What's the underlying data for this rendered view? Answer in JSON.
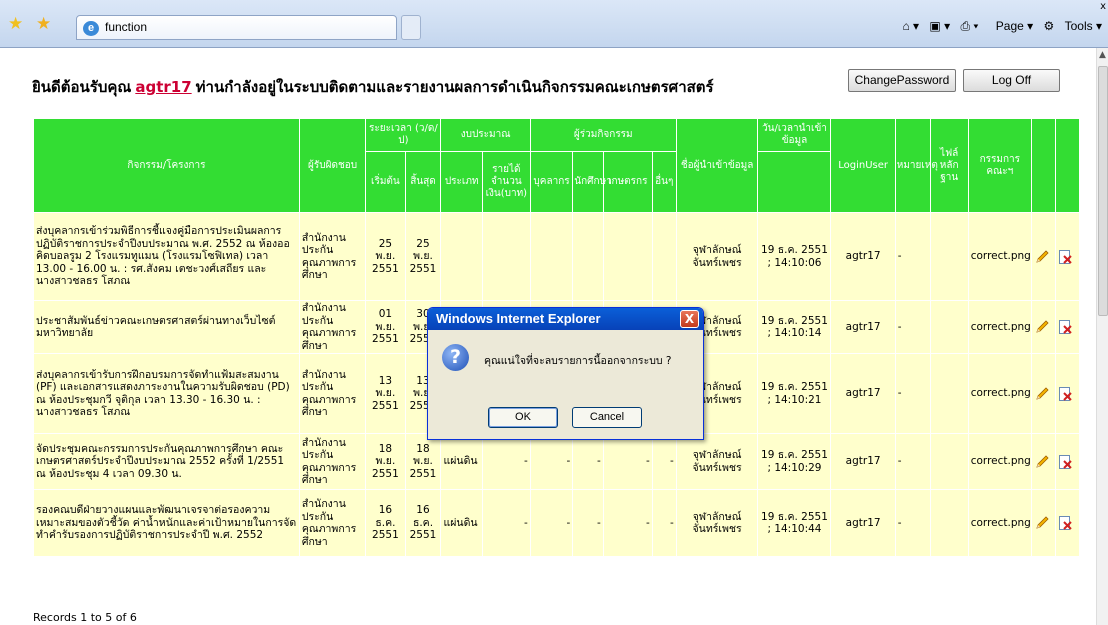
{
  "browser": {
    "tab_title": "function",
    "tools": [
      "Page",
      "Tools"
    ],
    "close_glyph": "x"
  },
  "header": {
    "welcome_prefix": "ยินดีต้อนรับคุณ",
    "username": "agtr17",
    "welcome_suffix": "ท่านกำลังอยู่ในระบบติดตามและรายงานผลการดำเนินกิจกรรมคณะเกษตรศาสตร์",
    "change_password": "ChangePassword",
    "log_off": "Log Off"
  },
  "table": {
    "headers": {
      "activity": "กิจกรรม/โครงการ",
      "responsible": "ผู้รับผิดชอบ",
      "period": "ระยะเวลา (ว/ด/ป)",
      "budget": "งบประมาณ",
      "participants": "ผู้ร่วมกิจกรรม",
      "entered_by": "ชื่อผู้นำเข้าข้อมูล",
      "entered_at": "วัน/เวลานำเข้าข้อมูล",
      "login_user": "LoginUser",
      "note": "หมายเหตุ",
      "evidence": "ไฟล์หลักฐาน",
      "committee": "กรรมการคณะฯ",
      "start": "เริ่มต้น",
      "end": "สิ้นสุด",
      "type": "ประเภท",
      "amount": "รายได้จำนวนเงิน(บาท)",
      "staff": "บุคลากร",
      "student": "นักศึกษา",
      "farmer": "เกษตรกร",
      "other": "อื่นๆ"
    },
    "rows": [
      {
        "activity": "ส่งบุคลากรเข้าร่วมพิธีการชี้แจงคู่มือการประเมินผลการปฏิบัติราชการประจำปีงบประมาณ พ.ศ. 2552 ณ ห้องออคิดบอลรูม 2 โรงแรมทูแมน (โรงแรมโซฟิเทล) เวลา 13.00 - 16.00 น. : รศ.สังคม เตชะวงศ์เสถียร และนางสาวชลธร โสภณ",
        "responsible": "สำนักงานประกันคุณภาพการศึกษา",
        "start": "25 พ.ย. 2551",
        "end": "25 พ.ย. 2551",
        "type": "",
        "amount": "",
        "staff": "",
        "student": "",
        "farmer": "",
        "other": "",
        "entered_by": "จุฬาลักษณ์ จันทร์เพชร",
        "entered_at": "19 ธ.ค. 2551 ; 14:10:06",
        "login_user": "agtr17",
        "note": "-",
        "evidence": "",
        "committee": "correct.png"
      },
      {
        "activity": "ประชาสัมพันธ์ข่าวคณะเกษตรศาสตร์ผ่านทางเว็บไซต์มหาวิทยาลัย",
        "responsible": "สำนักงานประกันคุณภาพการศึกษา",
        "start": "01 พ.ย. 2551",
        "end": "30 พ.ย. 2551",
        "type": "",
        "amount": "",
        "staff": "",
        "student": "",
        "farmer": "",
        "other": "",
        "entered_by": "จุฬาลักษณ์ จันทร์เพชร",
        "entered_at": "19 ธ.ค. 2551 ; 14:10:14",
        "login_user": "agtr17",
        "note": "-",
        "evidence": "",
        "committee": "correct.png"
      },
      {
        "activity": "ส่งบุคลากรเข้ารับการฝึกอบรมการจัดทำแฟ้มสะสมงาน (PF) และเอกสารแสดงภาระงานในความรับผิดชอบ (PD) ณ ห้องประชุมกวี จุติกุล เวลา 13.30 - 16.30 น. : นางสาวชลธร โสภณ",
        "responsible": "สำนักงานประกันคุณภาพการศึกษา",
        "start": "13 พ.ย. 2551",
        "end": "13 พ.ย. 2551",
        "type": "แผ่นดิน",
        "amount": "-",
        "staff": "-",
        "student": "-",
        "farmer": "-",
        "other": "-",
        "entered_by": "จุฬาลักษณ์ จันทร์เพชร",
        "entered_at": "19 ธ.ค. 2551 ; 14:10:21",
        "login_user": "agtr17",
        "note": "-",
        "evidence": "",
        "committee": "correct.png"
      },
      {
        "activity": "จัดประชุมคณะกรรมการประกันคุณภาพการศึกษา คณะเกษตรศาสตร์ประจำปีงบประมาณ 2552 ครั้งที่ 1/2551 ณ ห้องประชุม 4 เวลา 09.30 น.",
        "responsible": "สำนักงานประกันคุณภาพการศึกษา",
        "start": "18 พ.ย. 2551",
        "end": "18 พ.ย. 2551",
        "type": "แผ่นดิน",
        "amount": "-",
        "staff": "-",
        "student": "-",
        "farmer": "-",
        "other": "-",
        "entered_by": "จุฬาลักษณ์ จันทร์เพชร",
        "entered_at": "19 ธ.ค. 2551 ; 14:10:29",
        "login_user": "agtr17",
        "note": "-",
        "evidence": "",
        "committee": "correct.png"
      },
      {
        "activity": "รองคณบดีฝ่ายวางแผนและพัฒนาเจรจาต่อรองความเหมาะสมของตัวชี้วัด ค่าน้ำหนักและค่าเป้าหมายในการจัดทำคำรับรองการปฏิบัติราชการประจำปี พ.ศ. 2552",
        "responsible": "สำนักงานประกันคุณภาพการศึกษา",
        "start": "16 ธ.ค. 2551",
        "end": "16 ธ.ค. 2551",
        "type": "แผ่นดิน",
        "amount": "-",
        "staff": "-",
        "student": "-",
        "farmer": "-",
        "other": "-",
        "entered_by": "จุฬาลักษณ์ จันทร์เพชร",
        "entered_at": "19 ธ.ค. 2551 ; 14:10:44",
        "login_user": "agtr17",
        "note": "-",
        "evidence": "",
        "committee": "correct.png"
      }
    ]
  },
  "footer": {
    "records": "Records 1 to 5 of 6"
  },
  "dialog": {
    "title": "Windows Internet Explorer",
    "message": "คุณแน่ใจที่จะลบรายการนี้ออกจากระบบ ?",
    "ok": "OK",
    "cancel": "Cancel",
    "icon_glyph": "?",
    "close_glyph": "X"
  },
  "icons": {
    "edit": "pencil-icon",
    "delete": "delete-icon",
    "favorites": "star-icon",
    "home": "home-icon"
  },
  "colors": {
    "header_bg": "#33dd33",
    "row_bg": "#ffffcc",
    "username": "#cc0033",
    "dialog_title": "#0a5fd8"
  }
}
